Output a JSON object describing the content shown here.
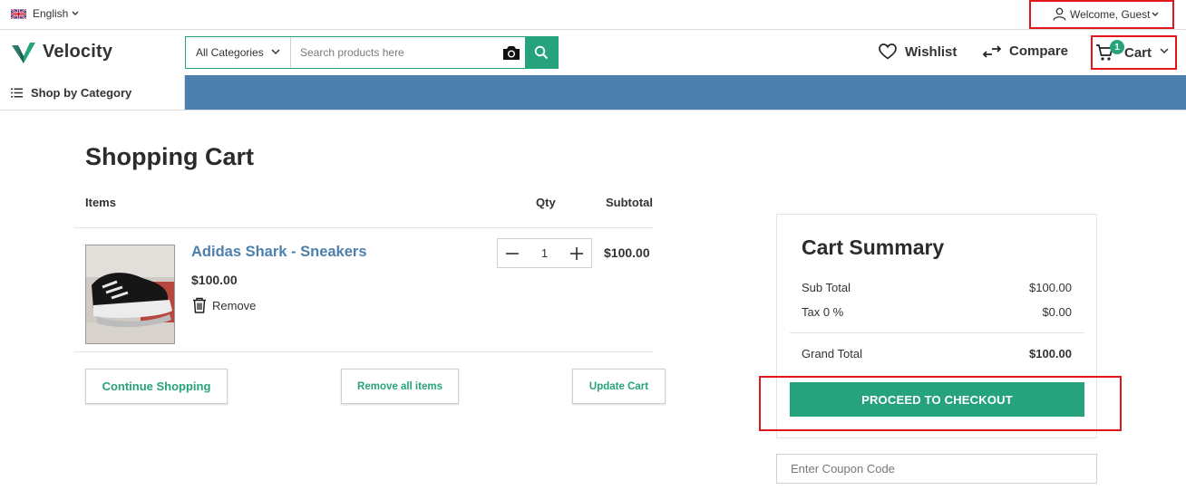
{
  "topbar": {
    "language": "English",
    "welcome": "Welcome, Guest"
  },
  "header": {
    "brand": "Velocity",
    "category_select": "All Categories",
    "search_placeholder": "Search products here",
    "wishlist": "Wishlist",
    "compare": "Compare",
    "cart": "Cart",
    "cart_count": "1"
  },
  "catbar": {
    "shop_by_category": "Shop by Category"
  },
  "cart": {
    "title": "Shopping Cart",
    "headers": {
      "items": "Items",
      "qty": "Qty",
      "subtotal": "Subtotal"
    },
    "items": [
      {
        "name": "Adidas Shark - Sneakers",
        "price": "$100.00",
        "remove": "Remove",
        "qty": "1",
        "subtotal": "$100.00"
      }
    ],
    "buttons": {
      "continue": "Continue Shopping",
      "remove_all": "Remove all items",
      "update": "Update Cart"
    }
  },
  "summary": {
    "title": "Cart Summary",
    "sub_total_label": "Sub Total",
    "sub_total": "$100.00",
    "tax_label": "Tax 0 %",
    "tax": "$0.00",
    "grand_total_label": "Grand Total",
    "grand_total": "$100.00",
    "checkout": "PROCEED TO CHECKOUT",
    "coupon_placeholder": "Enter Coupon Code"
  },
  "colors": {
    "accent": "#26a37c",
    "link": "#4d7fad",
    "highlight": "#e0181c"
  }
}
